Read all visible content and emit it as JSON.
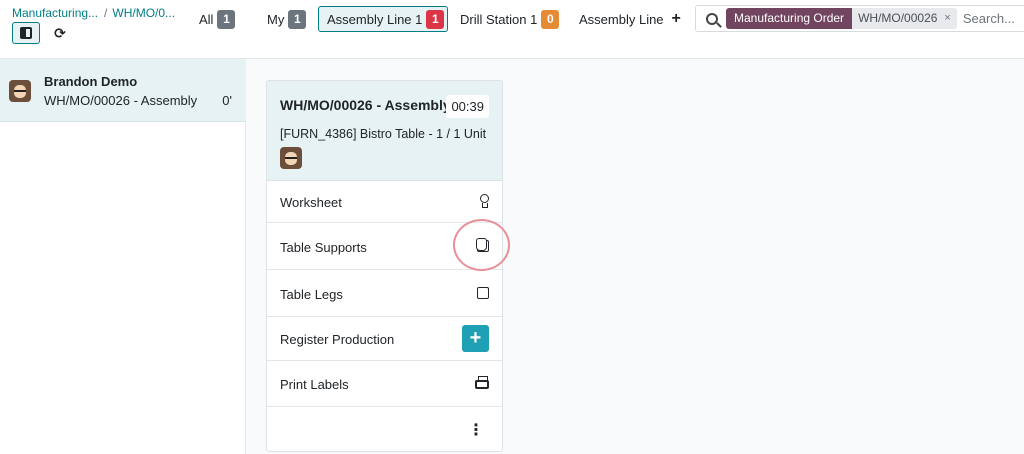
{
  "breadcrumb": {
    "root": "Manufacturing...",
    "separator": "/",
    "current": "WH/MO/0..."
  },
  "toolbar": {
    "sidebar_toggle_icon": "sidebar-icon",
    "refresh_icon": "refresh-icon",
    "refresh_glyph": "⟳"
  },
  "filters": [
    {
      "label": "All",
      "count": "1",
      "badge_color": "#6c757d"
    },
    {
      "label": "My",
      "count": "1",
      "badge_color": "#6c757d"
    },
    {
      "label": "Assembly Line 1",
      "count": "1",
      "badge_color": "#dc3545",
      "selected": true
    },
    {
      "label": "Drill Station 1",
      "count": "0",
      "badge_color": "#e58b36"
    },
    {
      "label": "Assembly Line",
      "add_glyph": "+"
    }
  ],
  "search": {
    "facet_label": "Manufacturing Order",
    "facet_value": "WH/MO/00026",
    "facet_remove": "×",
    "placeholder": "Search..."
  },
  "employee": {
    "name": "Brandon Demo",
    "subtitle": "WH/MO/00026 - Assembly",
    "time": "0'"
  },
  "card": {
    "title": "WH/MO/00026 - Assembly",
    "timer": "00:39",
    "product": "[FURN_4386] Bistro Table - 1 / 1 Unit",
    "steps": [
      {
        "label": "Worksheet",
        "icon": "bulb-icon"
      },
      {
        "label": "Table Supports",
        "icon": "checkbox-icon"
      },
      {
        "label": "Table Legs",
        "icon": "checkbox-icon"
      },
      {
        "label": "Register Production",
        "icon": "plus-icon",
        "glyph": "+"
      },
      {
        "label": "Print Labels",
        "icon": "printer-icon"
      }
    ],
    "more_glyph": "⋮"
  },
  "colors": {
    "accent": "#017e84",
    "highlight_row": "#e6f2f3",
    "facet": "#71445f",
    "action": "#1fa0b4"
  }
}
